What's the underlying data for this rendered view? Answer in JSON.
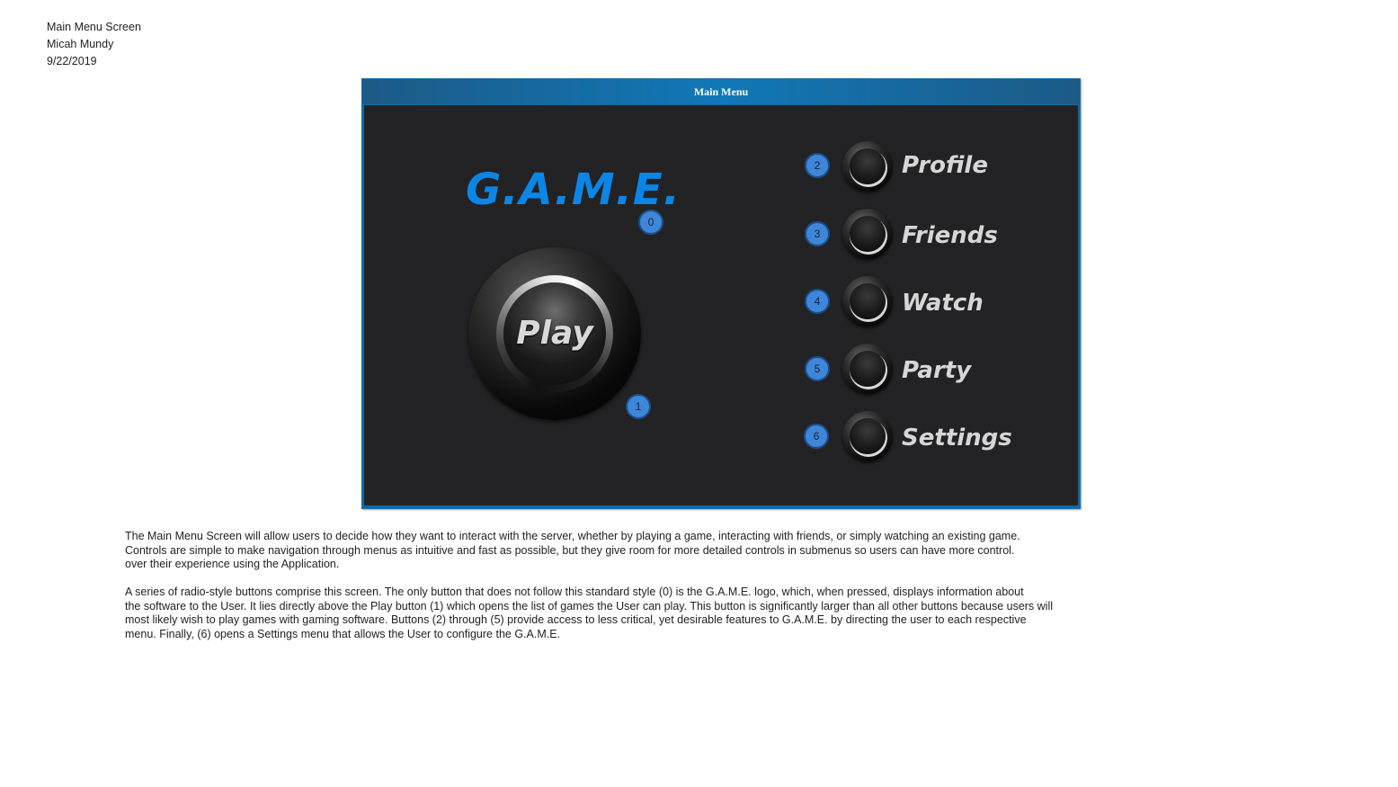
{
  "meta": {
    "title": "Main Menu Screen",
    "author": "Micah Mundy",
    "date": "9/22/2019"
  },
  "window": {
    "title": "Main Menu"
  },
  "logo": {
    "text": "G.A.M.E.",
    "color": "#0b86e6"
  },
  "play_button": {
    "label": "Play"
  },
  "menu": {
    "items": [
      {
        "label": "Profile"
      },
      {
        "label": "Friends"
      },
      {
        "label": "Watch"
      },
      {
        "label": "Party"
      },
      {
        "label": "Settings"
      }
    ]
  },
  "badges": [
    "0",
    "1",
    "2",
    "3",
    "4",
    "5",
    "6"
  ],
  "description": {
    "lines": [
      "The Main Menu Screen will allow users to decide how they want to interact with the server, whether by playing a game, interacting with friends, or simply watching an existing game.",
      "Controls are simple to make navigation through menus as intuitive and fast as possible, but they give room for more detailed controls in submenus so users can have more control.",
      "over their experience using the Application.",
      "A series of radio-style buttons comprise this screen. The only button that does not follow this standard style (0) is the G.A.M.E. logo, which, when pressed, displays information about",
      "the software to the User. It lies directly above the Play button (1) which opens the list of games the User can play. This button is significantly larger than all other buttons because users will",
      "most likely wish to play games with gaming software. Buttons (2) through (5) provide access to less critical, yet desirable features to G.A.M.E. by directing the user to each respective",
      "menu.  Finally, (6) opens a Settings menu that allows the User to configure the G.A.M.E."
    ]
  },
  "colors": {
    "window_border": "#1b6ea6",
    "titlebar": "#1178b8",
    "content_bg": "#232325",
    "badge_fill": "#3f86d8",
    "label_text": "#d6d6d6"
  }
}
